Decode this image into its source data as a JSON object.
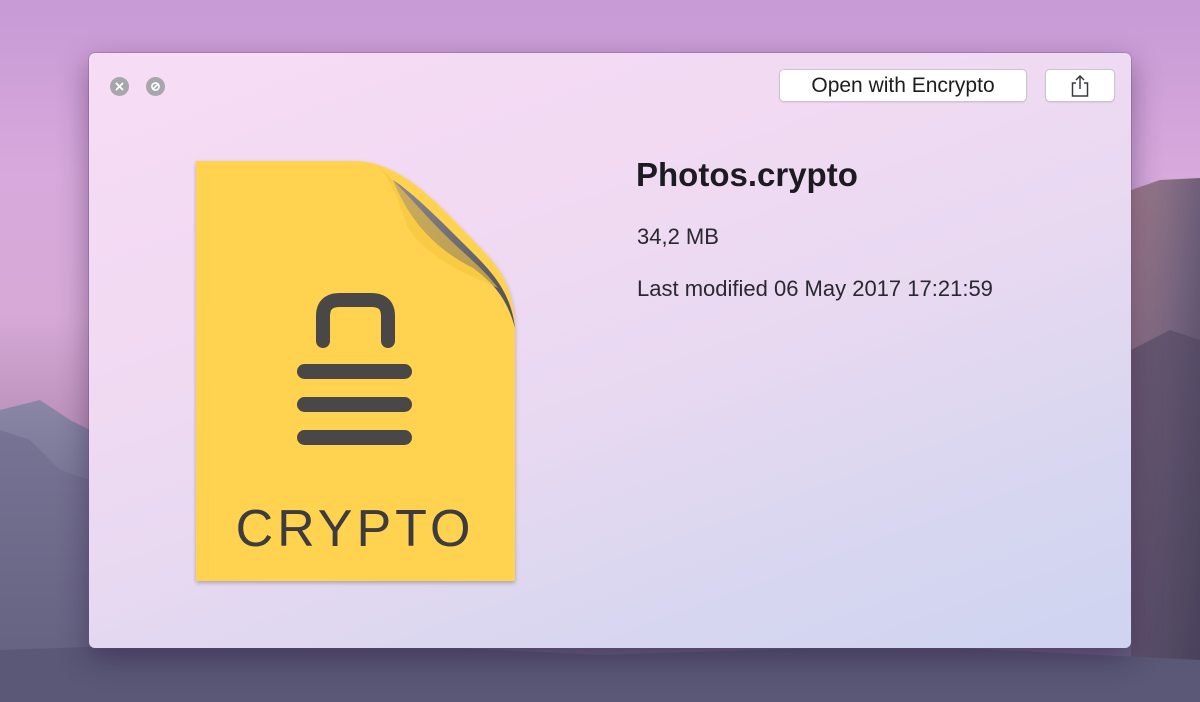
{
  "window": {
    "file_name": "Photos.crypto",
    "file_size": "34,2 MB",
    "last_modified": "Last modified 06 May 2017 17:21:59"
  },
  "toolbar": {
    "open_label": "Open with Encrypto"
  },
  "icon": {
    "label": "CRYPTO",
    "page_color": "#ffd34f",
    "fold_color": "#6b6870"
  },
  "icons": [
    "close-icon",
    "block-icon",
    "share-icon",
    "lock-icon"
  ]
}
